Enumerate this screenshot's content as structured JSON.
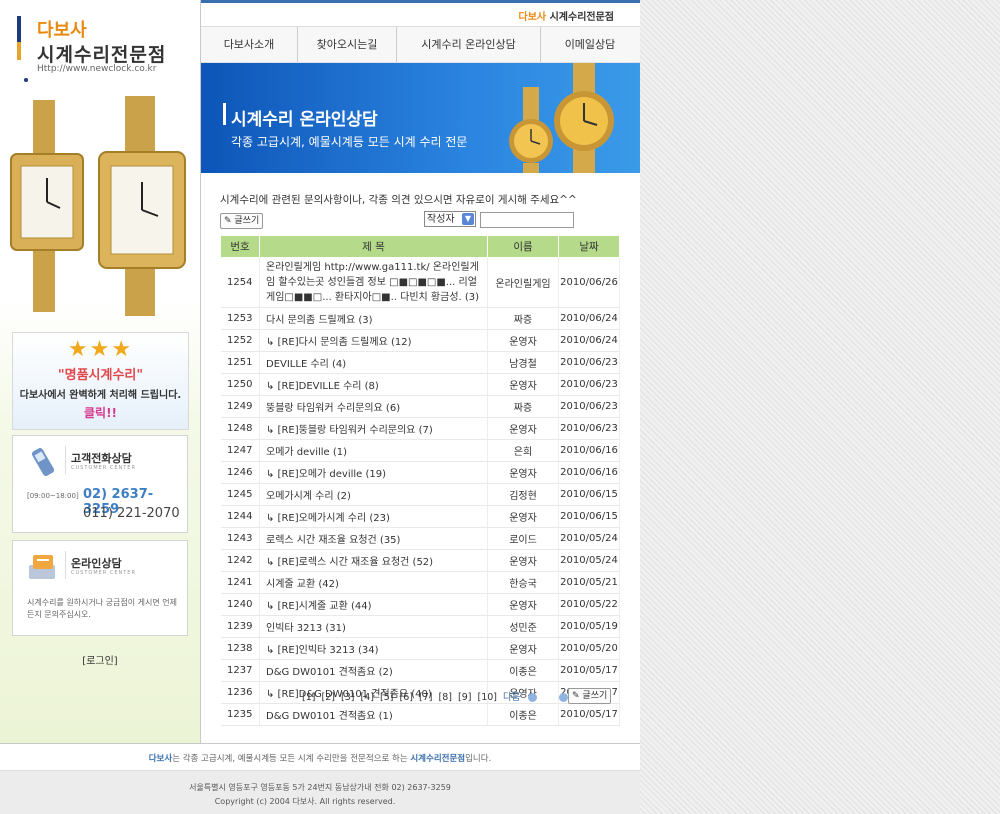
{
  "logo": {
    "name": "다보사",
    "tagline": "시계수리전문점",
    "url": "Http://www.newclock.co.kr"
  },
  "promo": {
    "title": "\"명품시계수리\"",
    "desc": "다보사에서 완벽하게 처리해 드립니다.",
    "click": "클릭!!"
  },
  "phone_box": {
    "title": "고객전화상담",
    "subtitle": "CUSTOMER CENTER",
    "hours": "[09:00~18:00]",
    "phone1": "02) 2637-3259",
    "phone2": "011) 221-2070"
  },
  "online_box": {
    "title": "온라인상담",
    "subtitle": "CUSTOMER CENTER",
    "desc": "시계수리를 원하시거나 궁금점이 게시면 언제든지 문의주십시오."
  },
  "login": "[로그인]",
  "header": {
    "brand": "다보사",
    "brand_suffix": "시계수리전문점"
  },
  "nav": [
    "다보사소개",
    "찾아오시는길",
    "시계수리 온라인상담",
    "이메일상담"
  ],
  "banner": {
    "title": "시계수리 온라인상담",
    "subtitle": "각종 고급시계, 예물시계등 모든 시계 수리 전문"
  },
  "board": {
    "intro": "시계수리에 관련된 문의사항이나, 각종 의견 있으시면 자유로이 게시해 주세요^^",
    "write_label": "글쓰기",
    "search_select": "작성자",
    "search_value": "",
    "headers": {
      "num": "번호",
      "subject": "제 목",
      "name": "이름",
      "date": "날짜"
    },
    "rows": [
      {
        "num": "1254",
        "subject": "온라인릴게임 http://www.ga111.tk/ 온라인릴게임 할수있는곳 성인들겜 정보 □■□■□■... 리얼게임□■■□... 환타지아□■.. 다빈치 황금성. (3)",
        "name": "온라인릴게임",
        "date": "2010/06/26"
      },
      {
        "num": "1253",
        "subject": "다시 문의좀 드릴께요 (3)",
        "name": "짜증",
        "date": "2010/06/24"
      },
      {
        "num": "1252",
        "subject": "↳ [RE]다시 문의좀 드릴께요 (12)",
        "name": "운영자",
        "date": "2010/06/24"
      },
      {
        "num": "1251",
        "subject": "DEVILLE 수리 (4)",
        "name": "남경철",
        "date": "2010/06/23"
      },
      {
        "num": "1250",
        "subject": "↳ [RE]DEVILLE 수리 (8)",
        "name": "운영자",
        "date": "2010/06/23"
      },
      {
        "num": "1249",
        "subject": "뚱블랑 타임워커 수리문의요 (6)",
        "name": "짜증",
        "date": "2010/06/23"
      },
      {
        "num": "1248",
        "subject": "↳ [RE]뚱블랑 타임워커 수리문의요 (7)",
        "name": "운영자",
        "date": "2010/06/23"
      },
      {
        "num": "1247",
        "subject": "오메가 deville (1)",
        "name": "은희",
        "date": "2010/06/16"
      },
      {
        "num": "1246",
        "subject": "↳ [RE]오메가 deville (19)",
        "name": "운영자",
        "date": "2010/06/16"
      },
      {
        "num": "1245",
        "subject": "오메가시계 수리 (2)",
        "name": "김정현",
        "date": "2010/06/15"
      },
      {
        "num": "1244",
        "subject": "↳ [RE]오메가시계 수리 (23)",
        "name": "운영자",
        "date": "2010/06/15"
      },
      {
        "num": "1243",
        "subject": "로렉스 시간 재조율 요청건 (35)",
        "name": "로이드",
        "date": "2010/05/24"
      },
      {
        "num": "1242",
        "subject": "↳ [RE]로렉스 시간 재조율 요청건 (52)",
        "name": "운영자",
        "date": "2010/05/24"
      },
      {
        "num": "1241",
        "subject": "시계줄 교환 (42)",
        "name": "한승국",
        "date": "2010/05/21"
      },
      {
        "num": "1240",
        "subject": "↳ [RE]시계줄 교환 (44)",
        "name": "운영자",
        "date": "2010/05/22"
      },
      {
        "num": "1239",
        "subject": "인빅타 3213 (31)",
        "name": "성민준",
        "date": "2010/05/19"
      },
      {
        "num": "1238",
        "subject": "↳ [RE]인빅타 3213 (34)",
        "name": "운영자",
        "date": "2010/05/20"
      },
      {
        "num": "1237",
        "subject": "D&G DW0101 견적좀요 (2)",
        "name": "이종은",
        "date": "2010/05/17"
      },
      {
        "num": "1236",
        "subject": "↳ [RE]D&G DW0101 견적좀요 (40)",
        "name": "운영자",
        "date": "2010/05/17"
      },
      {
        "num": "1235",
        "subject": "D&G DW0101 견적좀요 (1)",
        "name": "이종은",
        "date": "2010/05/17"
      }
    ],
    "pages": [
      "[1]",
      "[2]",
      "[3]",
      "[4]",
      "[5]",
      "[6]",
      "[7]",
      "[8]",
      "[9]",
      "[10]"
    ],
    "next_label": "다음"
  },
  "footer": {
    "line1_brand": "다보사",
    "line1_mid": "는 각종 고급시계, 예물시계등 모든 시계 수리만을 전문적으로 하는",
    "line1_hl": "시계수리전문점",
    "line1_end": "입니다.",
    "address": "서울특별시 영등포구 영등포동 5가 24번지 동남상가내   전화 02) 2637-3259",
    "copyright": "Copyright (c) 2004 다보사. All rights reserved."
  },
  "colors": {
    "nav_blue": "#3a6fae",
    "header_green": "#b4da8a",
    "brand_orange": "#e88a12",
    "banner_blue": "#0d55b8"
  }
}
